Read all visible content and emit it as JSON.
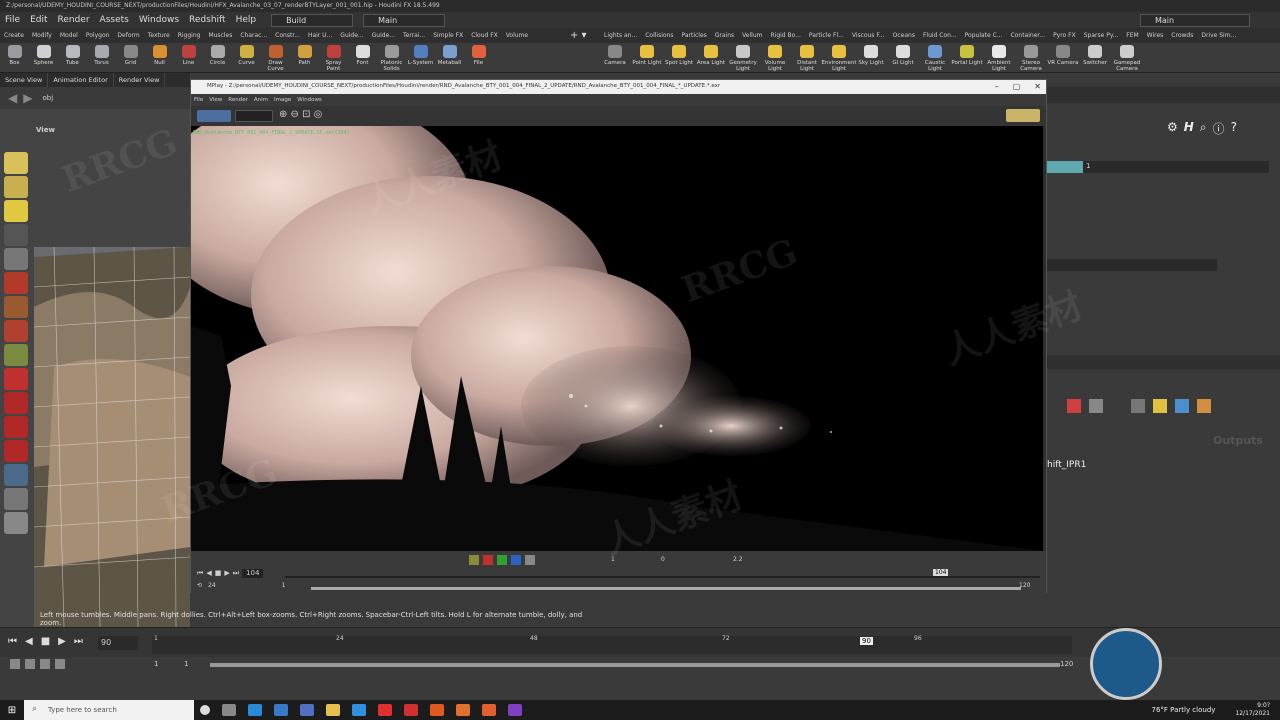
{
  "titlebar": {
    "text": "Z:/personal/UDEMY_HOUDINI_COURSE_NEXT/productionFiles/Houdini/HFX_Avalanche_03_07_renderBTYLayer_001_001.hip - Houdini FX 18.5.499"
  },
  "menubar": {
    "items": [
      "File",
      "Edit",
      "Render",
      "Assets",
      "Windows",
      "Redshift",
      "Help"
    ],
    "desktop_left": "Build",
    "desktop_mid": "Main",
    "desktop_right": "Main"
  },
  "shelf_tabs_left": [
    "Create",
    "Modify",
    "Model",
    "Polygon",
    "Deform",
    "Texture",
    "Rigging",
    "Muscles",
    "Charac...",
    "Constr...",
    "Hair U...",
    "Guide...",
    "Guide...",
    "Terrai...",
    "Simple FX",
    "Cloud FX",
    "Volume"
  ],
  "shelf_tabs_right": [
    "Lights an...",
    "Collisions",
    "Particles",
    "Grains",
    "Vellum",
    "Rigid Bo...",
    "Particle Fl...",
    "Viscous F...",
    "Oceans",
    "Fluid Con...",
    "Populate C...",
    "Container...",
    "Pyro FX",
    "Sparse Py...",
    "FEM",
    "Wires",
    "Crowds",
    "Drive Sim..."
  ],
  "tools_left": [
    "Box",
    "Sphere",
    "Tube",
    "Torus",
    "Grid",
    "Null",
    "Line",
    "Circle",
    "Curve",
    "Draw Curve",
    "Path",
    "Spray Paint",
    "Font",
    "Platonic Solids",
    "L-System",
    "Metaball",
    "File"
  ],
  "tools_right": [
    "Camera",
    "Point Light",
    "Spot Light",
    "Area Light",
    "Geometry Light",
    "Volume Light",
    "Distant Light",
    "Environment Light",
    "Sky Light",
    "GI Light",
    "Caustic Light",
    "Portal Light",
    "Ambient Light",
    "Stereo Camera",
    "VR Camera",
    "Switcher",
    "Gamepad Camera"
  ],
  "pane_tabs": [
    "Scene View",
    "Animation Editor",
    "Render View"
  ],
  "viewport": {
    "path": "obj",
    "label": "View"
  },
  "mplay": {
    "title": "MPlay - Z:/personal/UDEMY_HOUDINI_COURSE_NEXT/productionFiles/Houdini/render/RND_Avalanche_BTY_001_004_FINAL_2_UPDATE/RND_Avalanche_BTY_001_004_FINAL_*_UPDATE.*.exr",
    "menu": [
      "File",
      "View",
      "Render",
      "Anim",
      "Image",
      "Windows"
    ],
    "overlay": "RND_Avalanche_BTY_001_004_FINAL_2_UPDATE.1F.exr(104)",
    "frame": "104",
    "start": "1",
    "end": "120",
    "step": "24",
    "gamma": "1",
    "exposure": "0",
    "zoom": "2.2",
    "marker": "104"
  },
  "right_panel": {
    "value1": "1",
    "network_label": "Outputs",
    "node": "hift_IPR1"
  },
  "status": {
    "text": "Left mouse tumbles. Middle pans. Right dollies. Ctrl+Alt+Left box-zooms. Ctrl+Right zooms. Spacebar-Ctrl-Left tilts. Hold L for alternate tumble, dolly, and zoom."
  },
  "timeline": {
    "current_frame": "90",
    "ticks": [
      "1",
      "24",
      "48",
      "72",
      "96",
      "120"
    ],
    "range_start": "1",
    "range_start2": "1",
    "range_end": "120"
  },
  "taskbar": {
    "search_placeholder": "Type here to search",
    "weather": "76°F  Partly cloudy",
    "time": "9:0?",
    "date": "12/17/2021"
  },
  "watermarks": [
    "RRCG",
    "人人素材",
    "RRCG",
    "人人素材",
    "RRCG",
    "人人素材"
  ],
  "colors": {
    "accent": "#e07a2e",
    "mplay_title_bg": "#f0f0f0",
    "render_bg": "#000000"
  }
}
